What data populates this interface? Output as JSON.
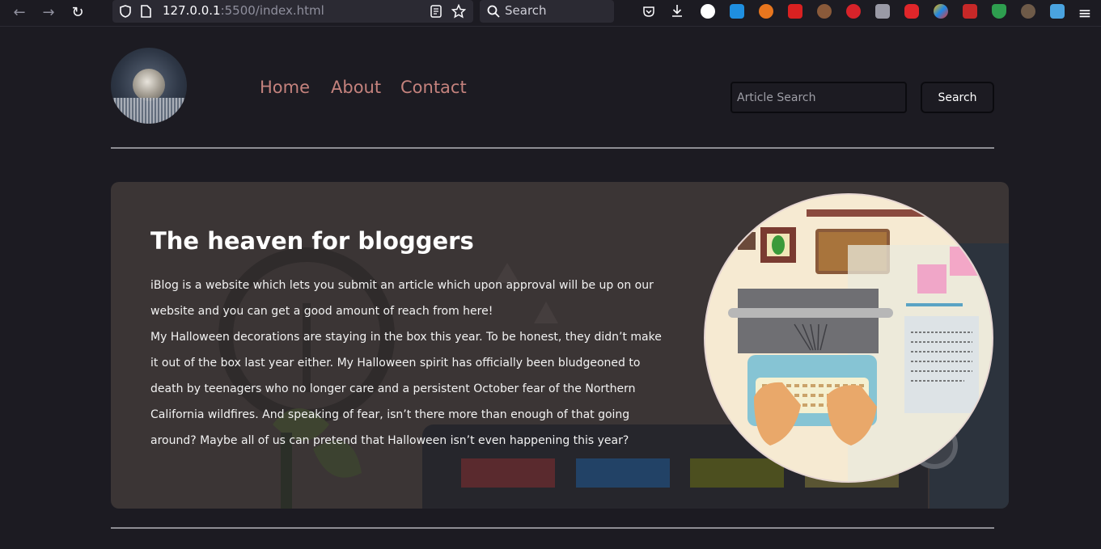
{
  "browser": {
    "url_host": "127.0.0.1",
    "url_path": ":5500/index.html",
    "search_placeholder": "Search"
  },
  "header": {
    "nav": [
      {
        "label": "Home"
      },
      {
        "label": "About"
      },
      {
        "label": "Contact"
      }
    ],
    "search": {
      "placeholder": "Article Search",
      "button_label": "Search"
    }
  },
  "hero": {
    "title": "The heaven for bloggers",
    "paragraph1": "iBlog is a website which lets you submit an article which upon approval will be up on our website and you can get a good amount of reach from here!",
    "paragraph2": "My Halloween decorations are staying in the box this year. To be honest, they didn’t make it out of the box last year either. My Halloween spirit has officially been bludgeoned to death by teenagers who no longer care and a persistent October fear of the Northern California wildfires. And speaking of fear, isn’t there more than enough of that going around? Maybe all of us can pretend that Halloween isn’t even happening this year?"
  },
  "colors": {
    "nav_link": "#c4827d",
    "page_bg": "#1c1b22",
    "hero_bg": "#3b3535"
  }
}
